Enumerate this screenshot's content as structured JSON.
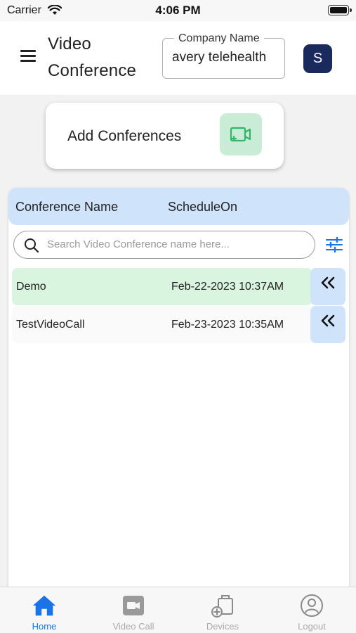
{
  "status_bar": {
    "carrier": "Carrier",
    "time": "4:06 PM"
  },
  "header": {
    "title": "Video Conference",
    "company_field": {
      "label": "Company Name",
      "value": "avery telehealth"
    },
    "avatar_initial": "S"
  },
  "add_card": {
    "label": "Add Conferences",
    "icon": "video-add-icon",
    "accent": "#34b46a"
  },
  "conference_list": {
    "columns": [
      "Conference Name",
      "ScheduleOn"
    ],
    "search_placeholder": "Search Video Conference name here...",
    "rows": [
      {
        "name": "Demo",
        "scheduled_on": "Feb-22-2023 10:37AM",
        "highlighted": true
      },
      {
        "name": "TestVideoCall",
        "scheduled_on": "Feb-23-2023 10:35AM",
        "highlighted": false
      }
    ],
    "row_action_icon": "double-chevron-left-icon"
  },
  "tabbar": {
    "active": "Home",
    "tabs": [
      {
        "label": "Home",
        "icon": "home-icon"
      },
      {
        "label": "Video Call",
        "icon": "video-camera-icon"
      },
      {
        "label": "Devices",
        "icon": "devices-icon"
      },
      {
        "label": "Logout",
        "icon": "logout-icon"
      }
    ]
  },
  "colors": {
    "header_blue": "#cfe3fb",
    "row_highlight": "#d9f5e0",
    "avatar_bg": "#1b2a5c",
    "active_tab": "#1a73e8",
    "filter_icon": "#1a73e8"
  }
}
